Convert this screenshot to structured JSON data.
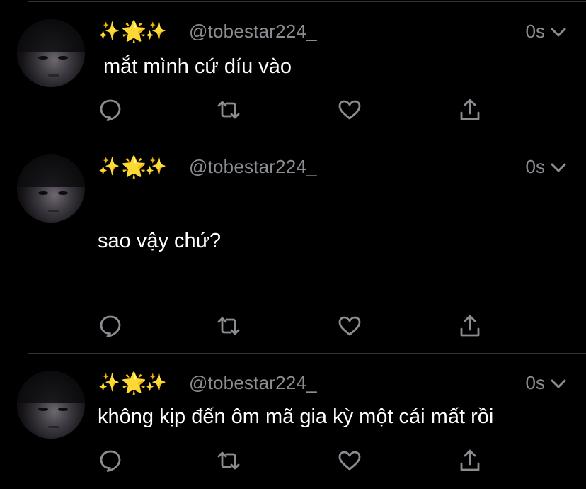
{
  "tweets": [
    {
      "emojis": [
        "✨",
        "🌟",
        "✨"
      ],
      "handle": "@tobestar224_",
      "time": "0s",
      "text": "mắt mình cứ díu vào",
      "actions": [
        "reply-icon",
        "retweet-icon",
        "like-icon",
        "share-icon"
      ]
    },
    {
      "emojis": [
        "✨",
        "🌟",
        "✨"
      ],
      "handle": "@tobestar224_",
      "time": "0s",
      "text": "sao vậy chứ?",
      "actions": [
        "reply-icon",
        "retweet-icon",
        "like-icon",
        "share-icon"
      ]
    },
    {
      "emojis": [
        "✨",
        "🌟",
        "✨"
      ],
      "handle": "@tobestar224_",
      "time": "0s",
      "text": "không kịp đến ôm mã gia kỳ một cái mất rồi",
      "actions": [
        "reply-icon",
        "retweet-icon",
        "like-icon",
        "share-icon"
      ]
    }
  ],
  "colors": {
    "background": "#000000",
    "text": "#ffffff",
    "muted": "#8a8d91",
    "divider": "#2f3336"
  }
}
